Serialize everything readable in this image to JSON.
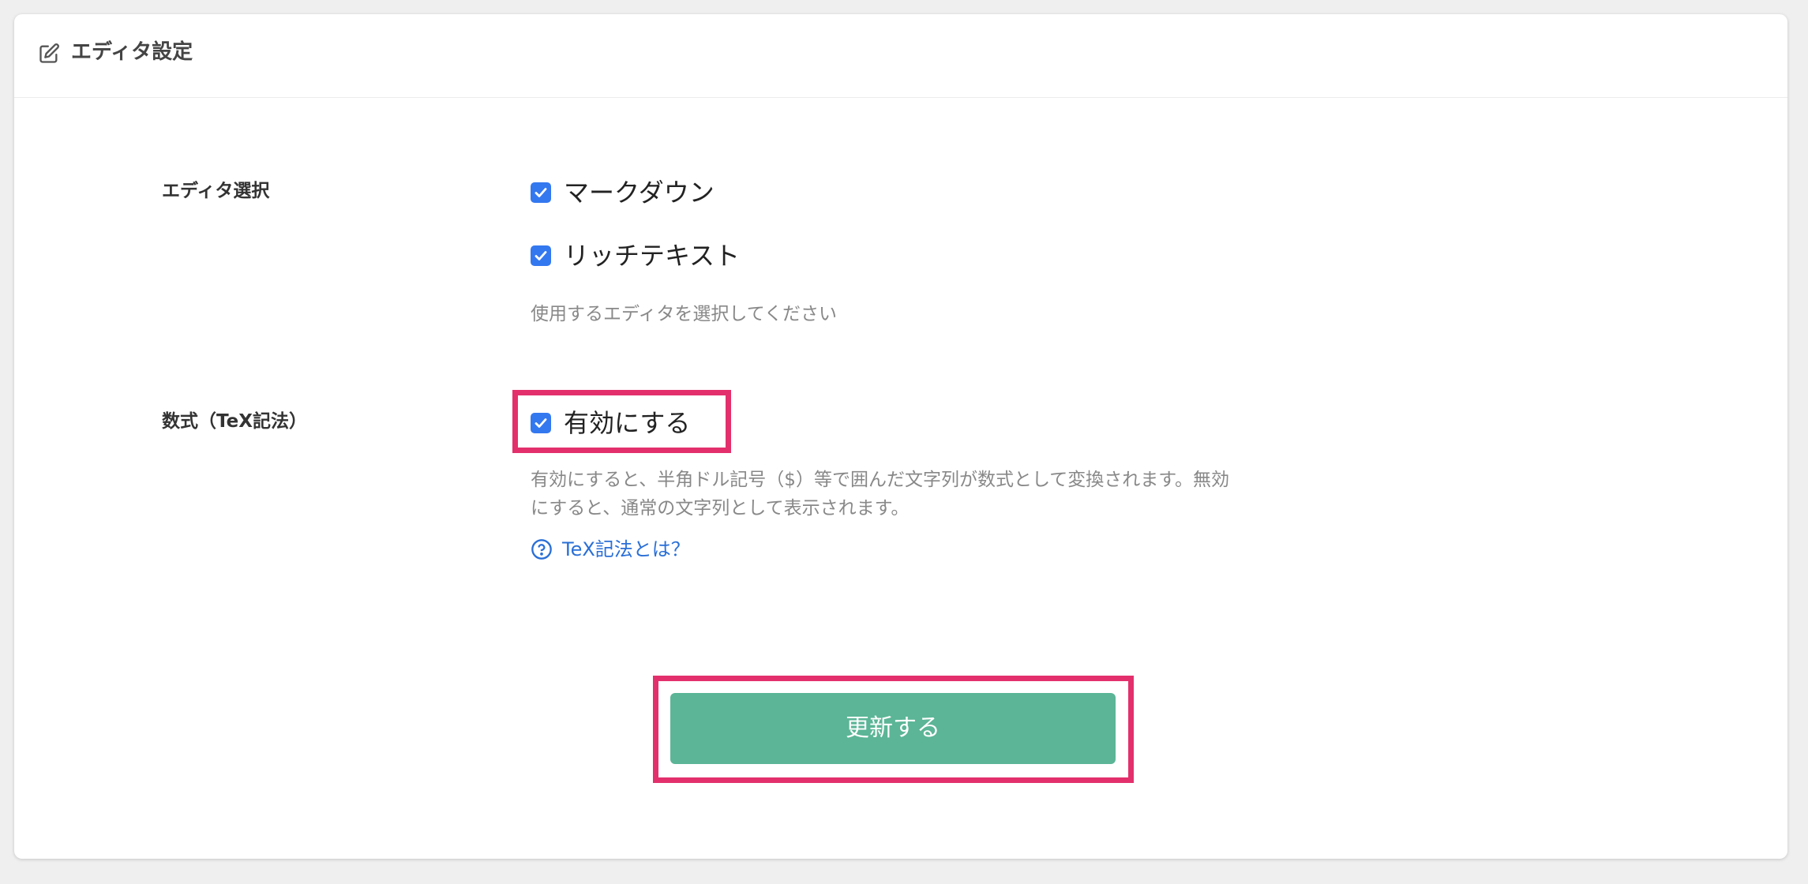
{
  "header": {
    "icon": "edit-icon",
    "title": "エディタ設定"
  },
  "editor_select": {
    "label": "エディタ選択",
    "options": [
      {
        "label": "マークダウン",
        "checked": true
      },
      {
        "label": "リッチテキスト",
        "checked": true
      }
    ],
    "help": "使用するエディタを選択してください"
  },
  "tex": {
    "label": "数式（TeX記法）",
    "option": {
      "label": "有効にする",
      "checked": true
    },
    "help_line1": "有効にすると、半角ドル記号（$）等で囲んだ文字列が数式として変換されます。無効",
    "help_line2": "にすると、通常の文字列として表示されます。",
    "link_icon": "question-circle-icon",
    "link_text": "TeX記法とは？"
  },
  "actions": {
    "update_label": "更新する"
  },
  "colors": {
    "checkbox": "#3478f0",
    "button": "#5bb596",
    "highlight": "#e3306c",
    "link": "#2a6fd6"
  }
}
